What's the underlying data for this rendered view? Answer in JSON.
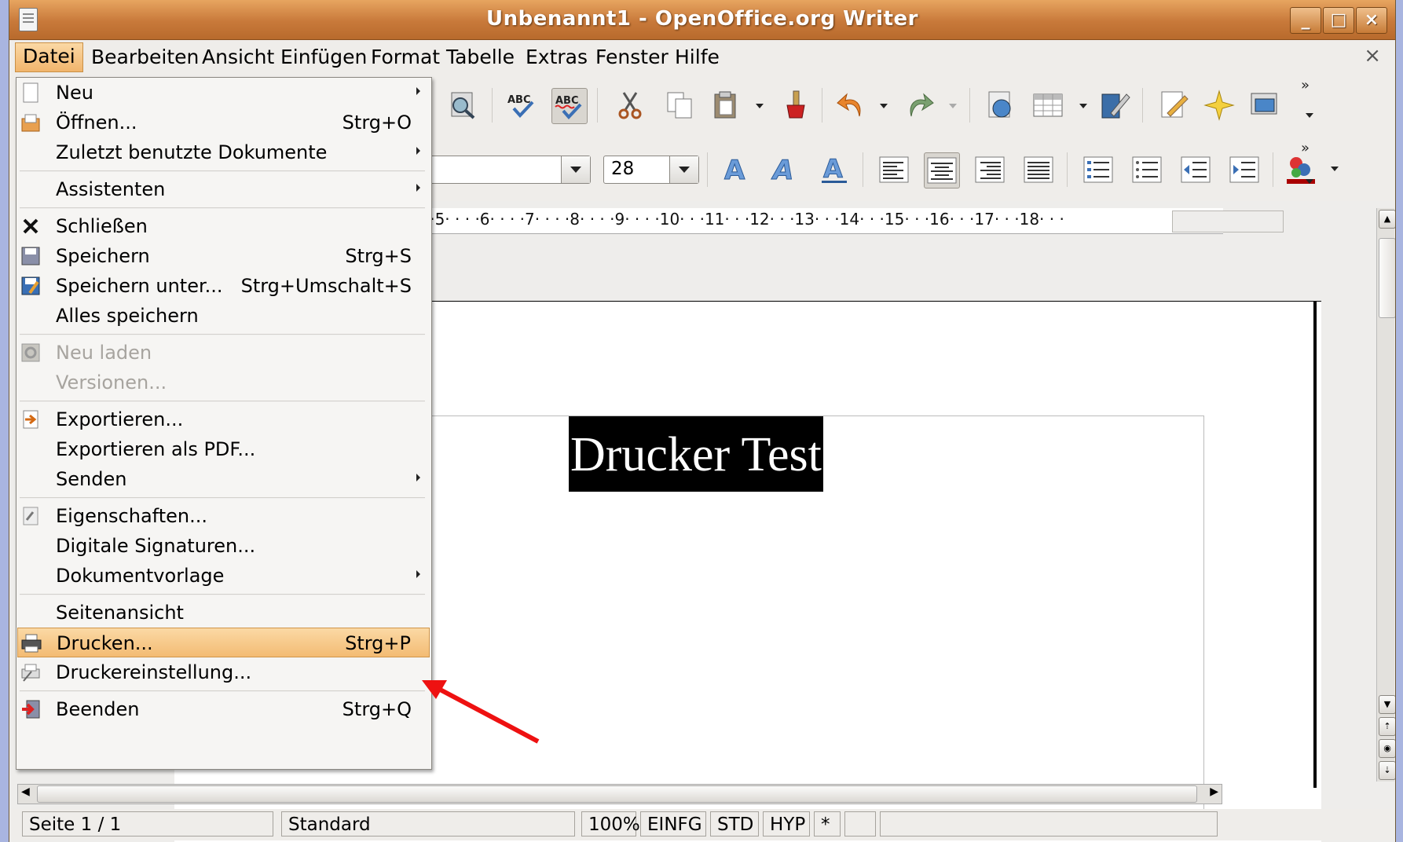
{
  "window": {
    "title": "Unbenannt1 - OpenOffice.org Writer",
    "minimize": "_",
    "maximize": "□",
    "close": "×"
  },
  "menubar": {
    "items": [
      {
        "label": "Datei"
      },
      {
        "label": "Bearbeiten"
      },
      {
        "label": "Ansicht"
      },
      {
        "label": "Einfügen"
      },
      {
        "label": "Format"
      },
      {
        "label": "Tabelle"
      },
      {
        "label": "Extras"
      },
      {
        "label": "Fenster"
      },
      {
        "label": "Hilfe"
      }
    ],
    "doc_close": "×"
  },
  "format_toolbar": {
    "font_size": "28"
  },
  "ruler": {
    "text": "·4· · · ·5· · · ·6· · · ·7· · · ·8· · · ·9· · · ·10· · ·11· · ·12· · ·13· · ·14· · ·15· · ·16· · ·17· · ·18· · ·"
  },
  "document": {
    "heading": "Drucker Test"
  },
  "file_menu": {
    "items": [
      {
        "label": "Neu",
        "accel": "",
        "submenu": true
      },
      {
        "label": "Öffnen...",
        "accel": "Strg+O"
      },
      {
        "label": "Zuletzt benutzte Dokumente",
        "accel": "",
        "submenu": true
      },
      {
        "label": "Assistenten",
        "accel": "",
        "submenu": true
      },
      {
        "label": "Schließen",
        "accel": ""
      },
      {
        "label": "Speichern",
        "accel": "Strg+S"
      },
      {
        "label": "Speichern unter...",
        "accel": "Strg+Umschalt+S"
      },
      {
        "label": "Alles speichern",
        "accel": ""
      },
      {
        "label": "Neu laden",
        "accel": "",
        "disabled": true
      },
      {
        "label": "Versionen...",
        "accel": "",
        "disabled": true
      },
      {
        "label": "Exportieren...",
        "accel": ""
      },
      {
        "label": "Exportieren als PDF...",
        "accel": ""
      },
      {
        "label": "Senden",
        "accel": "",
        "submenu": true
      },
      {
        "label": "Eigenschaften...",
        "accel": ""
      },
      {
        "label": "Digitale Signaturen...",
        "accel": ""
      },
      {
        "label": "Dokumentvorlage",
        "accel": "",
        "submenu": true
      },
      {
        "label": "Seitenansicht",
        "accel": ""
      },
      {
        "label": "Drucken...",
        "accel": "Strg+P",
        "highlighted": true
      },
      {
        "label": "Druckereinstellung...",
        "accel": ""
      },
      {
        "label": "Beenden",
        "accel": "Strg+Q"
      }
    ]
  },
  "statusbar": {
    "page": "Seite 1 / 1",
    "style": "Standard",
    "zoom": "100%",
    "insert_mode": "EINFG",
    "selection_mode": "STD",
    "hyperlink_mode": "HYP",
    "modified": "*"
  },
  "colors": {
    "accent": "#f3bb73",
    "title_bar": "#c8793a",
    "annotation_arrow": "#ee1111"
  }
}
